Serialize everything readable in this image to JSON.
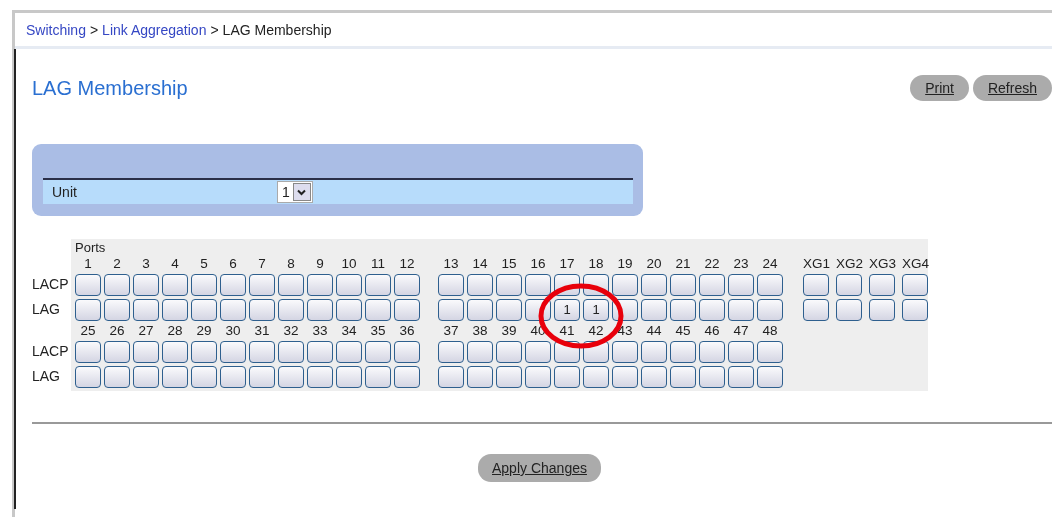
{
  "breadcrumb": [
    {
      "text": "Switching",
      "link": true
    },
    {
      "text": ">",
      "link": false
    },
    {
      "text": "Link Aggregation",
      "link": true
    },
    {
      "text": ">",
      "link": false
    },
    {
      "text": "LAG Membership",
      "link": false
    }
  ],
  "title": "LAG Membership",
  "buttons": [
    "Print",
    "Refresh"
  ],
  "unit": {
    "label": "Unit",
    "value": "1"
  },
  "ports_panel": {
    "heading": "Ports",
    "sections": [
      {
        "lacp_label": "LACP",
        "lag_label": "LAG",
        "groups": [
          {
            "kind": "port",
            "ports": [
              {
                "label": "1"
              },
              {
                "label": "2"
              },
              {
                "label": "3"
              },
              {
                "label": "4"
              },
              {
                "label": "5"
              },
              {
                "label": "6"
              },
              {
                "label": "7"
              },
              {
                "label": "8"
              },
              {
                "label": "9"
              },
              {
                "label": "10"
              },
              {
                "label": "11"
              },
              {
                "label": "12"
              }
            ]
          },
          {
            "kind": "port",
            "ports": [
              {
                "label": "13"
              },
              {
                "label": "14"
              },
              {
                "label": "15"
              },
              {
                "label": "16"
              },
              {
                "label": "17",
                "lag": "1"
              },
              {
                "label": "18",
                "lag": "1"
              },
              {
                "label": "19"
              },
              {
                "label": "20"
              },
              {
                "label": "21"
              },
              {
                "label": "22"
              },
              {
                "label": "23"
              },
              {
                "label": "24"
              }
            ]
          },
          {
            "kind": "xg",
            "ports": [
              {
                "label": "XG1"
              },
              {
                "label": "XG2"
              },
              {
                "label": "XG3"
              },
              {
                "label": "XG4"
              }
            ]
          }
        ]
      },
      {
        "lacp_label": "LACP",
        "lag_label": "LAG",
        "groups": [
          {
            "kind": "port",
            "ports": [
              {
                "label": "25"
              },
              {
                "label": "26"
              },
              {
                "label": "27"
              },
              {
                "label": "28"
              },
              {
                "label": "29"
              },
              {
                "label": "30"
              },
              {
                "label": "31"
              },
              {
                "label": "32"
              },
              {
                "label": "33"
              },
              {
                "label": "34"
              },
              {
                "label": "35"
              },
              {
                "label": "36"
              }
            ]
          },
          {
            "kind": "port",
            "ports": [
              {
                "label": "37"
              },
              {
                "label": "38"
              },
              {
                "label": "39"
              },
              {
                "label": "40"
              },
              {
                "label": "41"
              },
              {
                "label": "42"
              },
              {
                "label": "43"
              },
              {
                "label": "44"
              },
              {
                "label": "45"
              },
              {
                "label": "46"
              },
              {
                "label": "47"
              },
              {
                "label": "48"
              }
            ]
          }
        ]
      }
    ]
  },
  "highlight": {
    "kind": "ellipse"
  },
  "apply_button": "Apply Changes"
}
